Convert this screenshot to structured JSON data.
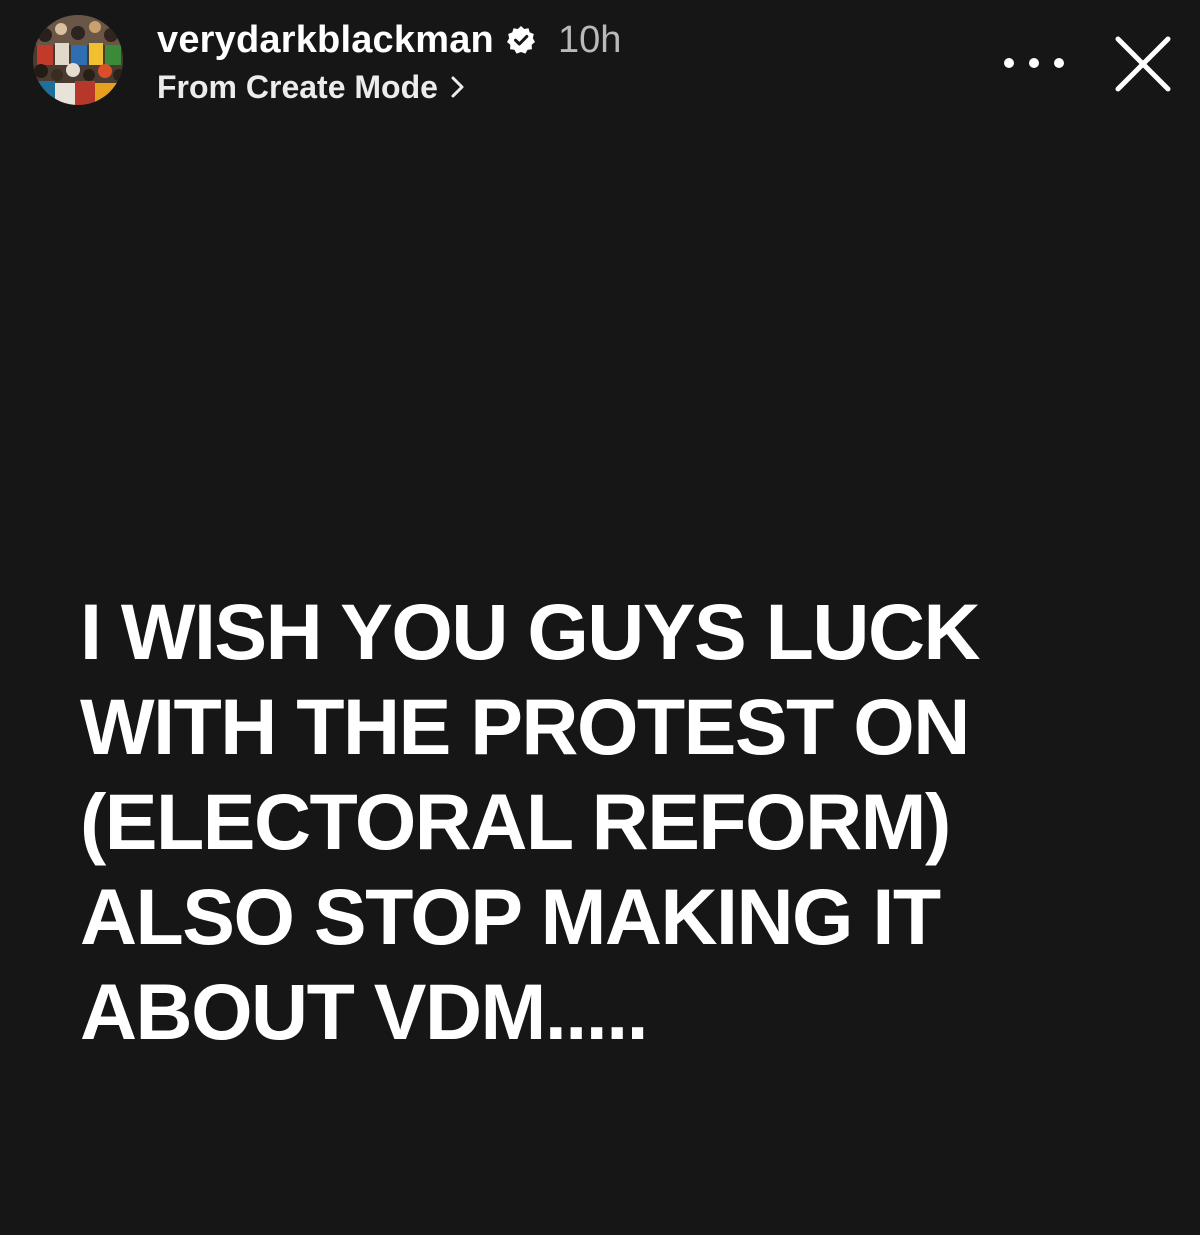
{
  "header": {
    "username": "verydarkblackman",
    "verified_icon": "verified-badge-icon",
    "time": "10h",
    "subtitle": "From Create Mode",
    "subtitle_icon": "chevron-right-icon",
    "more_icon": "more-options-icon",
    "close_icon": "close-icon",
    "avatar_icon": "avatar-crowd-photo"
  },
  "story": {
    "lines": [
      "I WISH YOU GUYS LUCK",
      "WITH THE PROTEST ON",
      "(ELECTORAL REFORM)",
      "ALSO STOP MAKING IT",
      "ABOUT VDM....."
    ]
  },
  "colors": {
    "background": "#161616",
    "text": "#ffffff",
    "time": "#b9b9b9"
  }
}
